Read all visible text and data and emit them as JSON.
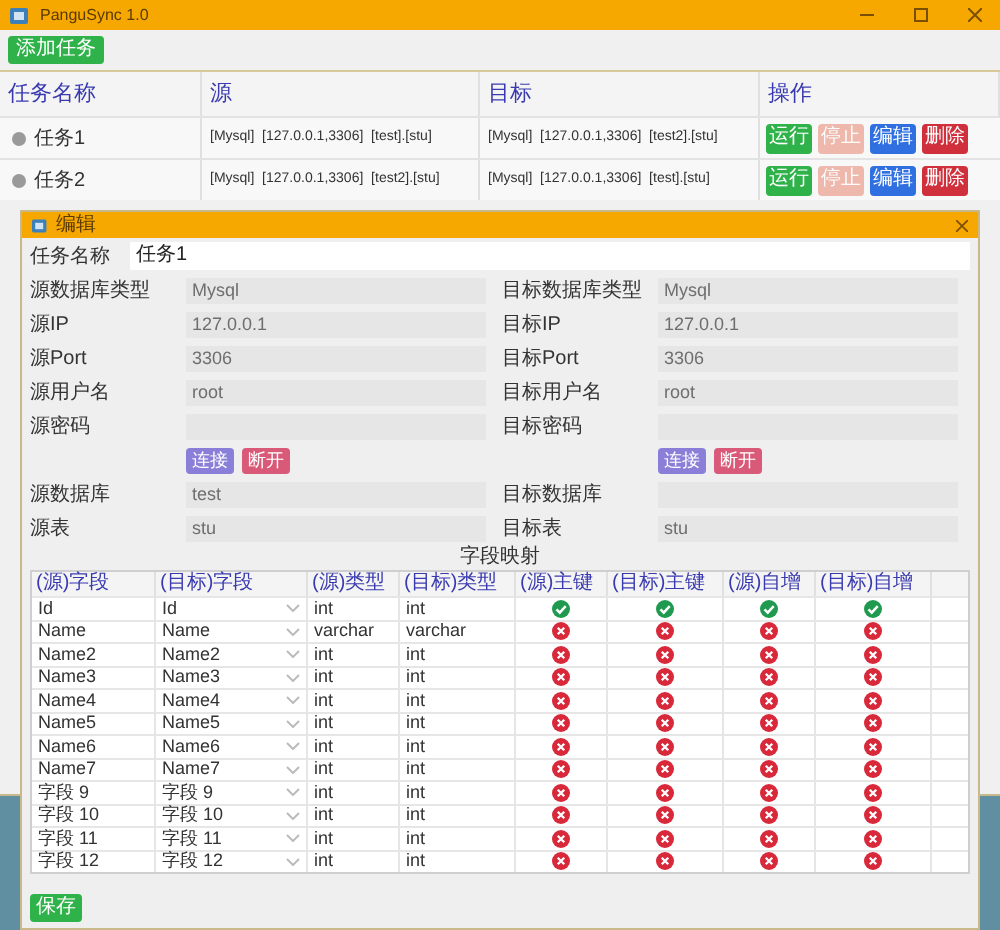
{
  "window": {
    "title": "PanguSync 1.0"
  },
  "toolbar": {
    "add_button": "添加任务"
  },
  "tasks": {
    "columns": [
      "任务名称",
      "源",
      "目标",
      "操作"
    ],
    "rows": [
      {
        "name": "任务1",
        "running": false,
        "source": "[Mysql]  [127.0.0.1,3306]  [test].[stu]",
        "target": "[Mysql]  [127.0.0.1,3306]  [test2].[stu]",
        "actions": [
          {
            "label": "运行",
            "kind": "run",
            "disabled": false
          },
          {
            "label": "停止",
            "kind": "stop",
            "disabled": true
          },
          {
            "label": "编辑",
            "kind": "edit",
            "disabled": false
          },
          {
            "label": "删除",
            "kind": "delete",
            "disabled": false
          }
        ]
      },
      {
        "name": "任务2",
        "running": false,
        "source": "[Mysql]  [127.0.0.1,3306]  [test2].[stu]",
        "target": "[Mysql]  [127.0.0.1,3306]  [test].[stu]",
        "actions": [
          {
            "label": "运行",
            "kind": "run",
            "disabled": false
          },
          {
            "label": "停止",
            "kind": "stop",
            "disabled": true
          },
          {
            "label": "编辑",
            "kind": "edit",
            "disabled": false
          },
          {
            "label": "删除",
            "kind": "delete",
            "disabled": false
          }
        ]
      }
    ]
  },
  "dialog": {
    "title": "编辑",
    "name_field": {
      "label": "任务名称",
      "value": "任务1"
    },
    "rows": [
      {
        "kind": "fields",
        "left": {
          "label": "源数据库类型",
          "value": "Mysql",
          "disabled": true
        },
        "right": {
          "label": "目标数据库类型",
          "value": "Mysql",
          "disabled": true
        }
      },
      {
        "kind": "fields",
        "left": {
          "label": "源IP",
          "value": "127.0.0.1",
          "disabled": true
        },
        "right": {
          "label": "目标IP",
          "value": "127.0.0.1",
          "disabled": true
        }
      },
      {
        "kind": "fields",
        "left": {
          "label": "源Port",
          "value": "3306",
          "disabled": true
        },
        "right": {
          "label": "目标Port",
          "value": "3306",
          "disabled": true
        }
      },
      {
        "kind": "fields",
        "left": {
          "label": "源用户名",
          "value": "root",
          "disabled": true
        },
        "right": {
          "label": "目标用户名",
          "value": "root",
          "disabled": true
        }
      },
      {
        "kind": "fields",
        "left": {
          "label": "源密码",
          "disabled": true
        },
        "right": {
          "label": "目标密码",
          "disabled": true
        }
      },
      {
        "kind": "buttons",
        "left": [
          "连接",
          "断开"
        ],
        "right": [
          "连接",
          "断开"
        ]
      },
      {
        "kind": "fields",
        "left": {
          "label": "源数据库",
          "value": "test",
          "disabled": true
        },
        "right": {
          "label": "目标数据库",
          "disabled": true
        }
      },
      {
        "kind": "fields",
        "left": {
          "label": "源表",
          "value": "stu",
          "disabled": true
        },
        "right": {
          "label": "目标表",
          "value": "stu",
          "disabled": true
        }
      }
    ],
    "mapping_title": "字段映射",
    "mapping_columns": [
      "(源)字段",
      "(目标)字段",
      "(源)类型",
      "(目标)类型",
      "(源)主键",
      "(目标)主键",
      "(源)自增",
      "(目标)自增"
    ],
    "fields": [
      {
        "src": "Id",
        "dst": "Id",
        "src_type": "int",
        "dst_type": "int",
        "src_pk": true,
        "dst_pk": true,
        "src_ai": true,
        "dst_ai": true
      },
      {
        "src": "Name",
        "dst": "Name",
        "src_type": "varchar",
        "dst_type": "varchar",
        "src_pk": false,
        "dst_pk": false,
        "src_ai": false,
        "dst_ai": false
      },
      {
        "src": "Name2",
        "dst": "Name2",
        "src_type": "int",
        "dst_type": "int",
        "src_pk": false,
        "dst_pk": false,
        "src_ai": false,
        "dst_ai": false
      },
      {
        "src": "Name3",
        "dst": "Name3",
        "src_type": "int",
        "dst_type": "int",
        "src_pk": false,
        "dst_pk": false,
        "src_ai": false,
        "dst_ai": false
      },
      {
        "src": "Name4",
        "dst": "Name4",
        "src_type": "int",
        "dst_type": "int",
        "src_pk": false,
        "dst_pk": false,
        "src_ai": false,
        "dst_ai": false
      },
      {
        "src": "Name5",
        "dst": "Name5",
        "src_type": "int",
        "dst_type": "int",
        "src_pk": false,
        "dst_pk": false,
        "src_ai": false,
        "dst_ai": false
      },
      {
        "src": "Name6",
        "dst": "Name6",
        "src_type": "int",
        "dst_type": "int",
        "src_pk": false,
        "dst_pk": false,
        "src_ai": false,
        "dst_ai": false
      },
      {
        "src": "Name7",
        "dst": "Name7",
        "src_type": "int",
        "dst_type": "int",
        "src_pk": false,
        "dst_pk": false,
        "src_ai": false,
        "dst_ai": false
      },
      {
        "src": "字段 9",
        "dst": "字段 9",
        "src_type": "int",
        "dst_type": "int",
        "src_pk": false,
        "dst_pk": false,
        "src_ai": false,
        "dst_ai": false
      },
      {
        "src": "字段 10",
        "dst": "字段 10",
        "src_type": "int",
        "dst_type": "int",
        "src_pk": false,
        "dst_pk": false,
        "src_ai": false,
        "dst_ai": false
      },
      {
        "src": "字段 11",
        "dst": "字段 11",
        "src_type": "int",
        "dst_type": "int",
        "src_pk": false,
        "dst_pk": false,
        "src_ai": false,
        "dst_ai": false
      },
      {
        "src": "字段 12",
        "dst": "字段 12",
        "src_type": "int",
        "dst_type": "int",
        "src_pk": false,
        "dst_pk": false,
        "src_ai": false,
        "dst_ai": false
      }
    ],
    "save_button": "保存"
  }
}
